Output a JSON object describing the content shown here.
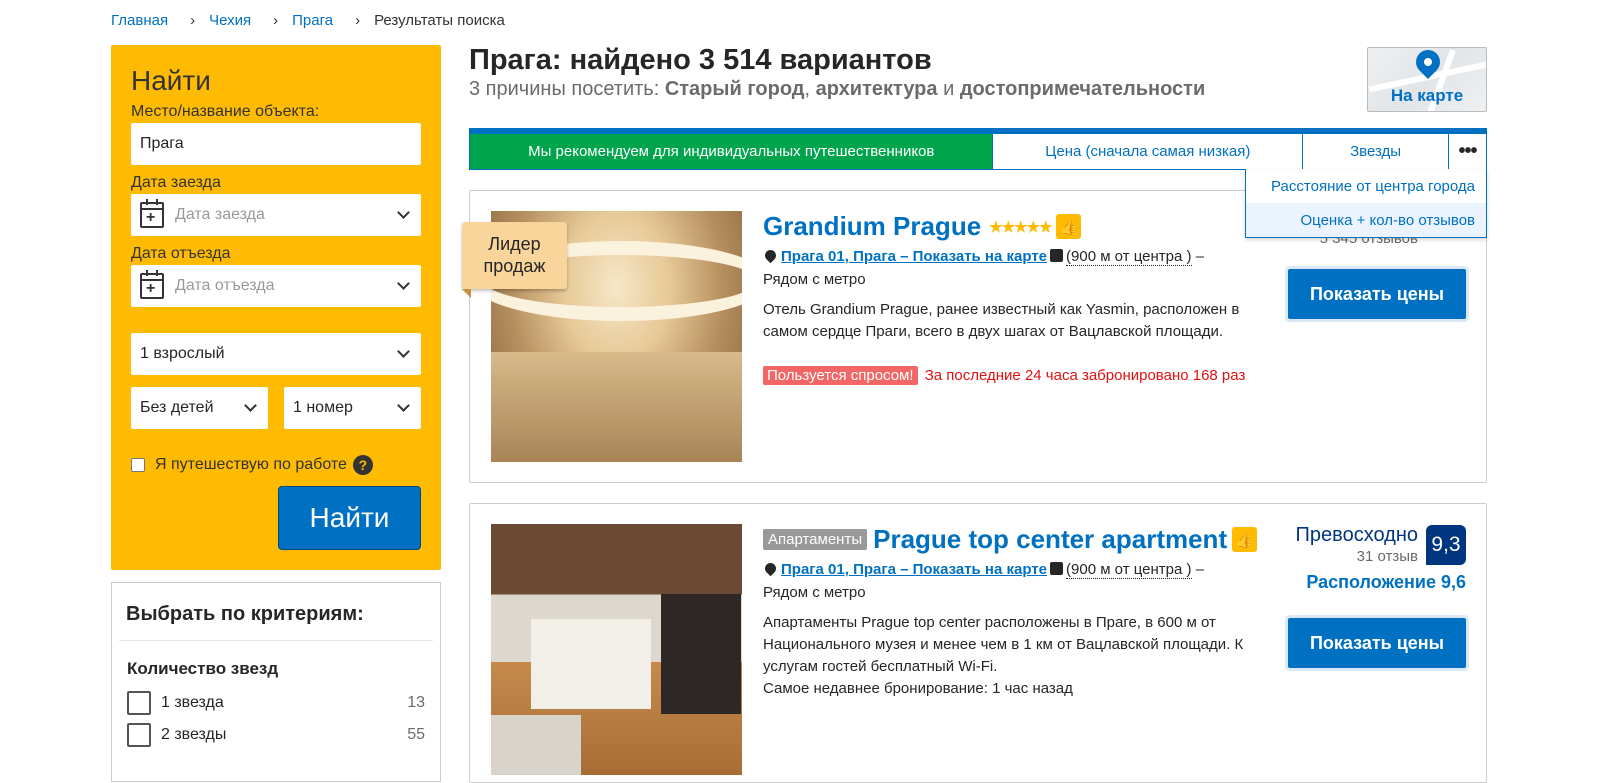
{
  "breadcrumb": [
    "Главная",
    "Чехия",
    "Прага",
    "Результаты поиска"
  ],
  "search": {
    "title": "Найти",
    "place_label": "Место/название объекта:",
    "place_value": "Прага",
    "checkin_label": "Дата заезда",
    "checkin_placeholder": "Дата заезда",
    "checkout_label": "Дата отъезда",
    "checkout_placeholder": "Дата отъезда",
    "adults": "1 взрослый",
    "children": "Без детей",
    "rooms": "1 номер",
    "work_trip": "Я путешествую по работе",
    "help": "?",
    "button": "Найти"
  },
  "filters": {
    "title": "Выбрать по критериям:",
    "stars_title": "Количество звезд",
    "items": [
      {
        "label": "1 звезда",
        "count": "13"
      },
      {
        "label": "2 звезды",
        "count": "55"
      }
    ]
  },
  "header": {
    "title": "Прага: найдено 3 514 вариантов",
    "reasons_prefix": "3 причины посетить: ",
    "reason1": "Старый город",
    "sep1": ", ",
    "reason2": "архитектура",
    "sep2": " и ",
    "reason3": "достопримечательности",
    "map_label": "На карте"
  },
  "sort": {
    "tabs": [
      "Мы рекомендуем для индивидуальных путешественников",
      "Цена (сначала самая низкая)",
      "Звезды",
      "•••"
    ],
    "dropdown": [
      "Расстояние от центра города",
      "Оценка + кол-во отзывов"
    ]
  },
  "hotels": [
    {
      "name": "Grandium Prague",
      "stars": "★★★★★",
      "badge": "Лидер продаж",
      "location_link": "Прага 01, Прага – Показать на карте",
      "distance": "(900 м от центра )",
      "metro": "– Рядом с метро",
      "description": "Отель Grandium Prague, ранее известный как Yasmin, расположен в самом сердце Праги, всего в двух шагах от Вацлавской площади.",
      "demand_tag": "Пользуется спросом!",
      "demand_text": " За последние 24 часа забронировано 168 раз",
      "reviews": "5 345 отзывов",
      "button": "Показать цены"
    },
    {
      "type_badge": "Апартаменты",
      "name": "Prague top center apartment",
      "location_link": "Прага 01, Прага – Показать на карте",
      "distance": "(900 м от центра )",
      "metro": "– Рядом с метро",
      "description": "Апартаменты Prague top center расположены в Праге, в 600 м от Национального музея и менее чем в 1 км от Вацлавской площади. К услугам гостей бесплатный Wi-Fi.",
      "recent": "Самое недавнее бронирование: 1 час назад",
      "verdict": "Превосходно",
      "reviews": "31 отзыв",
      "score": "9,3",
      "location_score": "Расположение 9,6",
      "button": "Показать цены"
    }
  ],
  "colors": {
    "brand_blue": "#0071c2",
    "search_yellow": "#febb02",
    "active_sort_green": "#00a44c",
    "score_navy": "#003580",
    "demand_red": "#e21111"
  }
}
